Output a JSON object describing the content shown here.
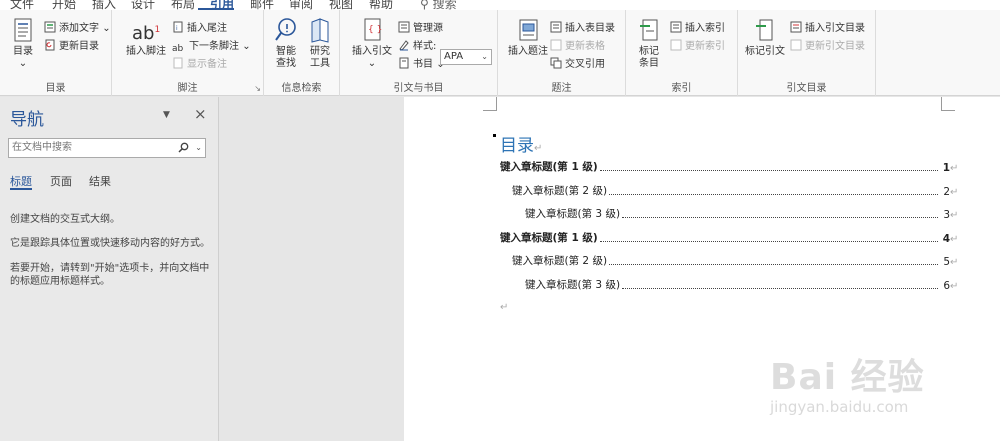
{
  "menu": {
    "tabs": [
      "文件",
      "开始",
      "插入",
      "设计",
      "布局",
      "引用",
      "邮件",
      "审阅",
      "视图",
      "帮助"
    ],
    "active": "引用",
    "search_label": "搜索"
  },
  "ribbon": {
    "groups": {
      "toc": {
        "label": "目录",
        "toc_button": "目录",
        "add_text": "添加文字",
        "update_toc": "更新目录"
      },
      "footnotes": {
        "label": "脚注",
        "insert_footnote": "插入脚注",
        "insert_endnote": "插入尾注",
        "next_footnote": "下一条脚注",
        "show_notes": "显示备注",
        "ab_glyph": "ab",
        "ab_sup": "1"
      },
      "research": {
        "label": "信息检索",
        "smart_lookup_1": "智能",
        "smart_lookup_2": "查找",
        "researcher_1": "研究",
        "researcher_2": "工具"
      },
      "citations": {
        "label": "引文与书目",
        "insert_citation": "插入引文",
        "manage_sources": "管理源",
        "style_label": "样式:",
        "style_value": "APA",
        "bibliography": "书目"
      },
      "captions": {
        "label": "题注",
        "insert_caption": "插入题注",
        "insert_table_of_figures": "插入表目录",
        "update_table": "更新表格",
        "cross_reference": "交叉引用"
      },
      "index": {
        "label": "索引",
        "mark_entry_1": "标记",
        "mark_entry_2": "条目",
        "insert_index": "插入索引",
        "update_index": "更新索引"
      },
      "toa": {
        "label": "引文目录",
        "mark_citation": "标记引文",
        "insert_toa": "插入引文目录",
        "update_toa": "更新引文目录"
      }
    }
  },
  "nav": {
    "title": "导航",
    "search_placeholder": "在文档中搜索",
    "tabs": [
      "标题",
      "页面",
      "结果"
    ],
    "messages": [
      "创建文档的交互式大纲。",
      "它是跟踪具体位置或快速移动内容的好方式。",
      "若要开始，请转到\"开始\"选项卡，并向文档中的标题应用标题样式。"
    ]
  },
  "document": {
    "toc_title": "目录",
    "para_mark": "↵",
    "entries": [
      {
        "text": "键入章标题(第 1 级)",
        "page": "1",
        "level": 1
      },
      {
        "text": "键入章标题(第 2 级)",
        "page": "2",
        "level": 2
      },
      {
        "text": "键入章标题(第 3 级)",
        "page": "3",
        "level": 3
      },
      {
        "text": "键入章标题(第 1 级)",
        "page": "4",
        "level": 1
      },
      {
        "text": "键入章标题(第 2 级)",
        "page": "5",
        "level": 2
      },
      {
        "text": "键入章标题(第 3 级)",
        "page": "6",
        "level": 3
      }
    ]
  },
  "watermark": {
    "text": "Bai 经验",
    "url": "jingyan.baidu.com"
  }
}
